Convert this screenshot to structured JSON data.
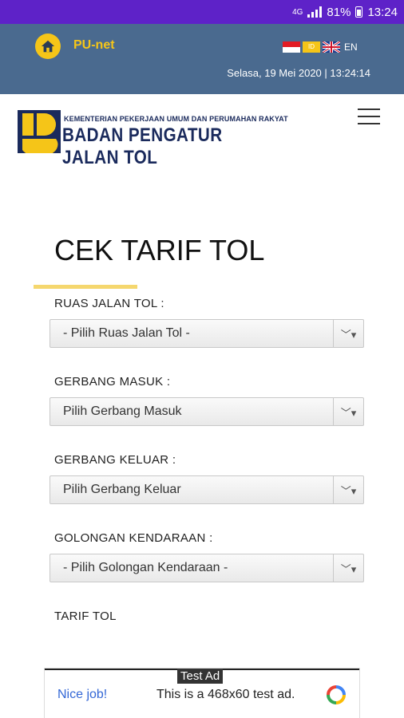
{
  "status_bar": {
    "battery": "81%",
    "time": "13:24",
    "network": "4G"
  },
  "header": {
    "brand": "PU-net",
    "lang_id_label": "ID",
    "lang_en_label": "EN",
    "datetime": "Selasa, 19 Mei 2020 | 13:24:14"
  },
  "logo": {
    "ministry": "KEMENTERIAN PEKERJAAN UMUM DAN PERUMAHAN RAKYAT",
    "agency": "BADAN PENGATUR JALAN TOL"
  },
  "page": {
    "title": "CEK TARIF TOL"
  },
  "form": {
    "ruas": {
      "label": "RUAS JALAN TOL :",
      "value": "- Pilih Ruas Jalan Tol -"
    },
    "masuk": {
      "label": "GERBANG MASUK :",
      "value": "Pilih Gerbang Masuk"
    },
    "keluar": {
      "label": "GERBANG KELUAR :",
      "value": "Pilih Gerbang Keluar"
    },
    "golongan": {
      "label": "GOLONGAN KENDARAAN :",
      "value": "- Pilih Golongan Kendaraan -"
    },
    "tarif_label": "TARIF TOL"
  },
  "ad": {
    "badge": "Test Ad",
    "headline": "Nice job!",
    "text": "This is a 468x60 test ad."
  },
  "colors": {
    "status_bar": "#5e22c8",
    "header": "#4a6a8f",
    "accent": "#f5c518",
    "logo_navy": "#1a2a5c"
  }
}
